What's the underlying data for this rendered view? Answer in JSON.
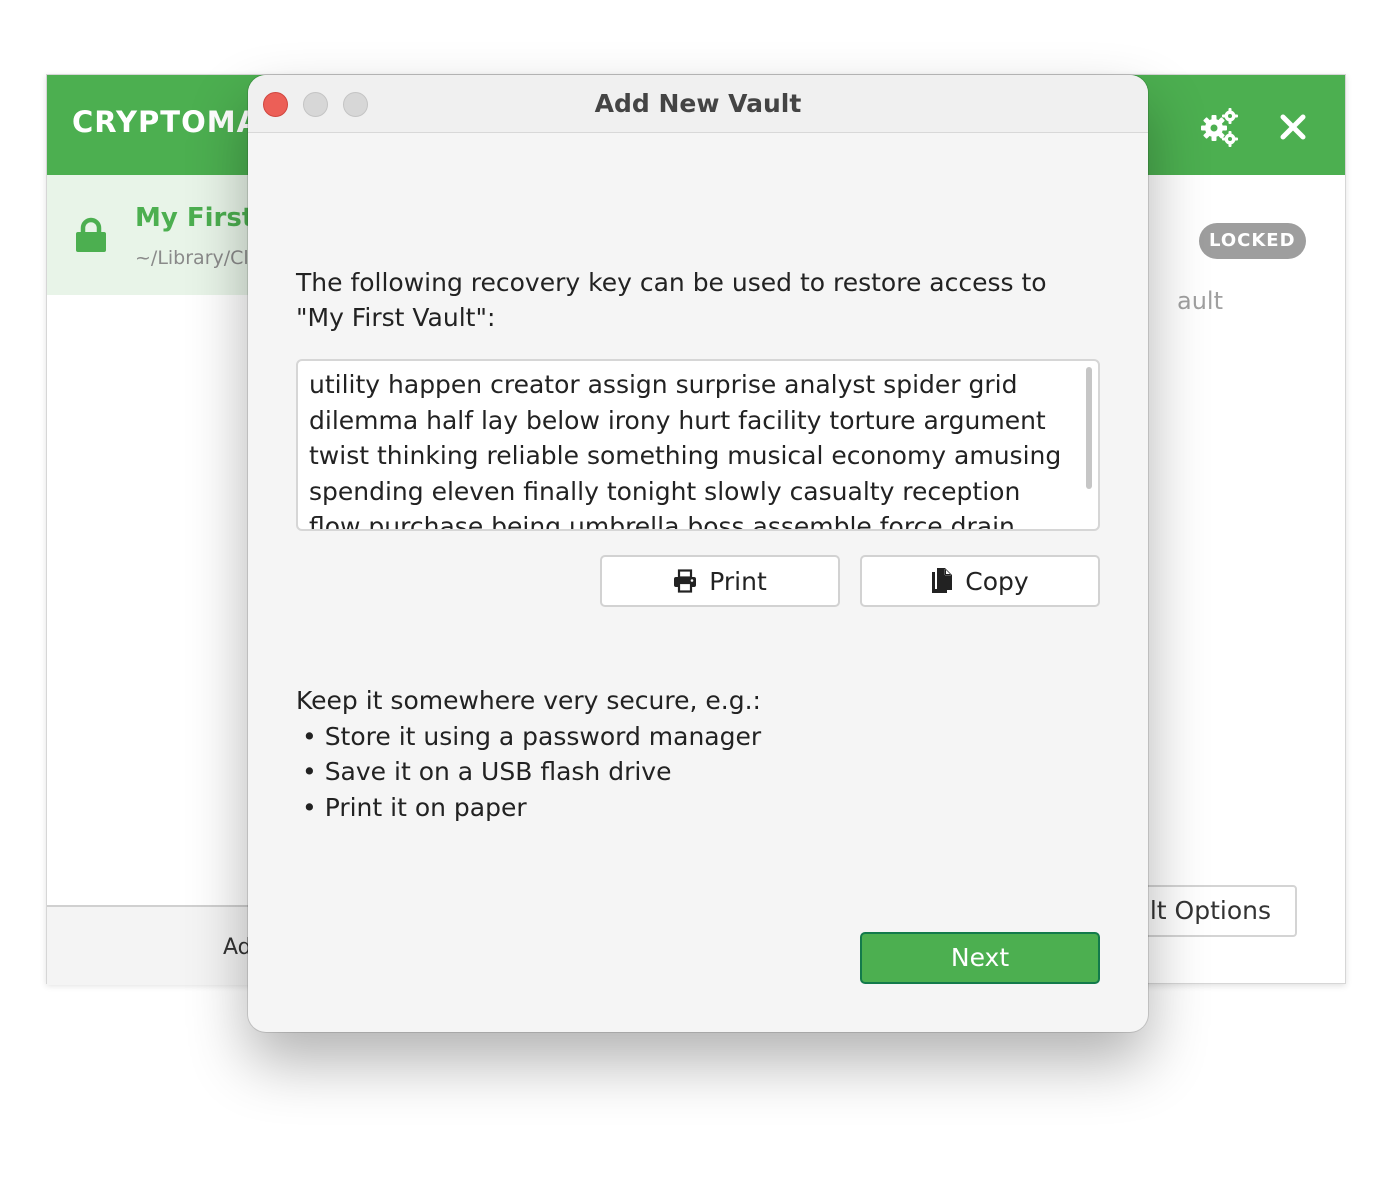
{
  "main_window": {
    "app_title": "CRYPTOMATOR",
    "vault": {
      "name": "My First Vault",
      "path": "~/Library/Cloud",
      "status": "LOCKED",
      "detail_sub": "ault"
    },
    "add_vault_label": "Ad",
    "vault_options_label": "lt Options",
    "header_icons": [
      "gear-icon",
      "close-icon"
    ],
    "brand_color": "#4caf50"
  },
  "dialog": {
    "title": "Add New Vault",
    "intro": "The following recovery key can be used to restore access to \"My First Vault\":",
    "recovery_key": "utility happen creator assign surprise analyst spider grid dilemma half lay below irony hurt facility torture argument twist thinking reliable something musical economy amusing spending eleven finally tonight slowly casualty reception flow purchase being umbrella boss assemble force drain shrink",
    "print_label": "Print",
    "copy_label": "Copy",
    "tips_heading": "Keep it somewhere very secure, e.g.:",
    "tips": [
      "• Store it using a password manager",
      "• Save it on a USB flash drive",
      "• Print it on paper"
    ],
    "next_label": "Next"
  }
}
